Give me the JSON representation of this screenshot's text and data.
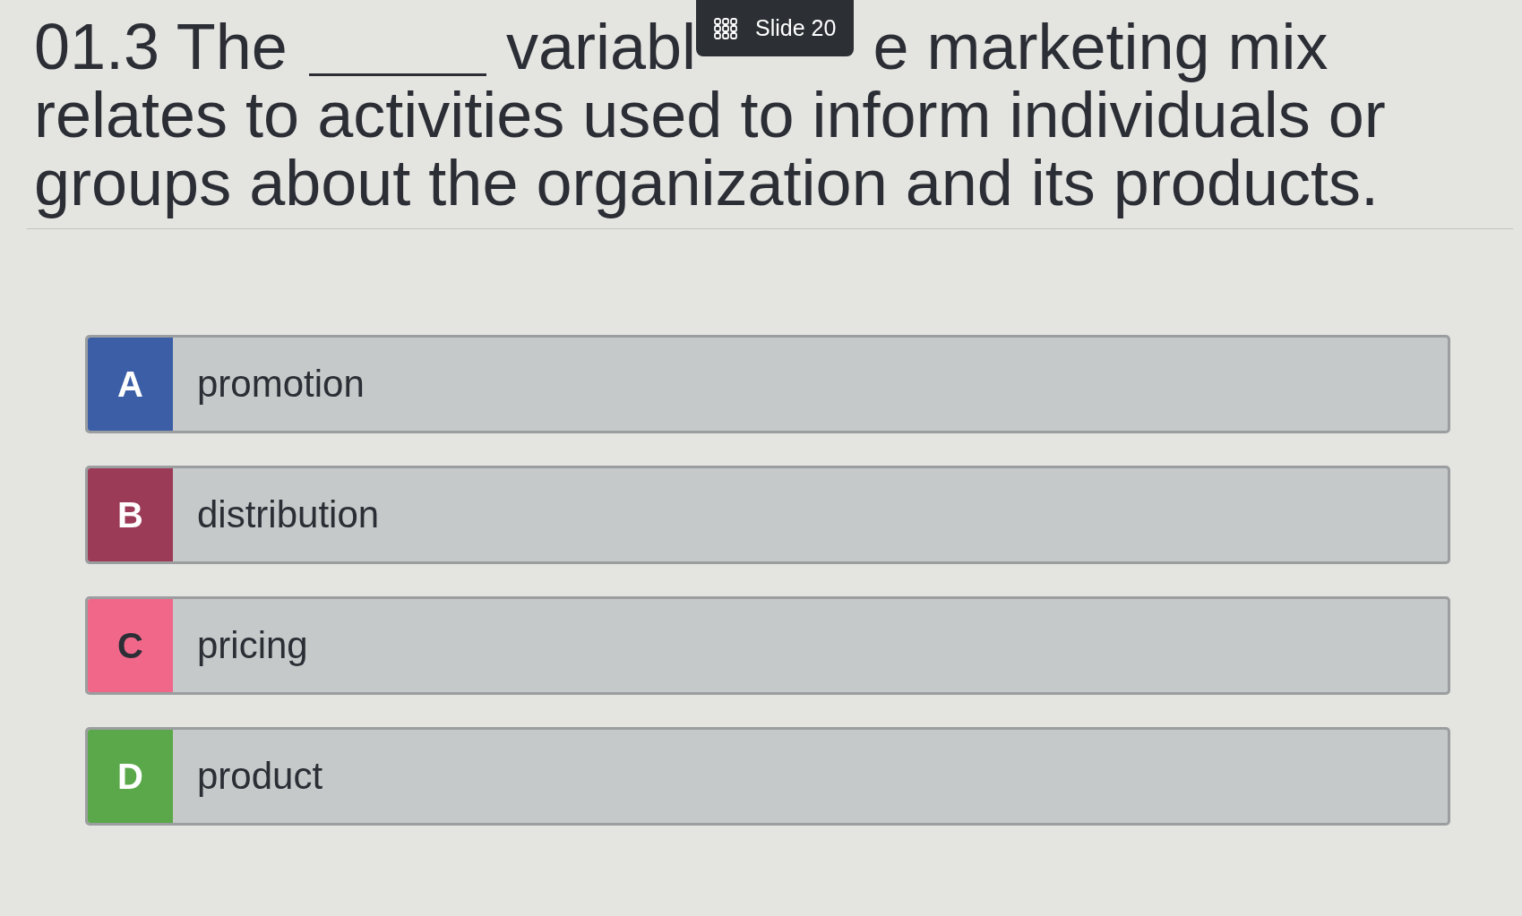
{
  "question": {
    "parts": [
      {
        "kind": "text",
        "text": "01.3 The"
      },
      {
        "kind": "blank"
      },
      {
        "kind": "text",
        "text": "variabl"
      },
      {
        "kind": "slide_badge",
        "label": "Slide 20"
      },
      {
        "kind": "text",
        "text": "e marketing mix"
      }
    ],
    "continuation": "relates to activities used to inform individuals or groups about the organization and its products."
  },
  "options": [
    {
      "letter": "A",
      "text": "promotion",
      "color": "#3b5ea6"
    },
    {
      "letter": "B",
      "text": "distribution",
      "color": "#9b3b57"
    },
    {
      "letter": "C",
      "text": "pricing",
      "color": "#f0678a"
    },
    {
      "letter": "D",
      "text": "product",
      "color": "#5aa84a"
    }
  ]
}
